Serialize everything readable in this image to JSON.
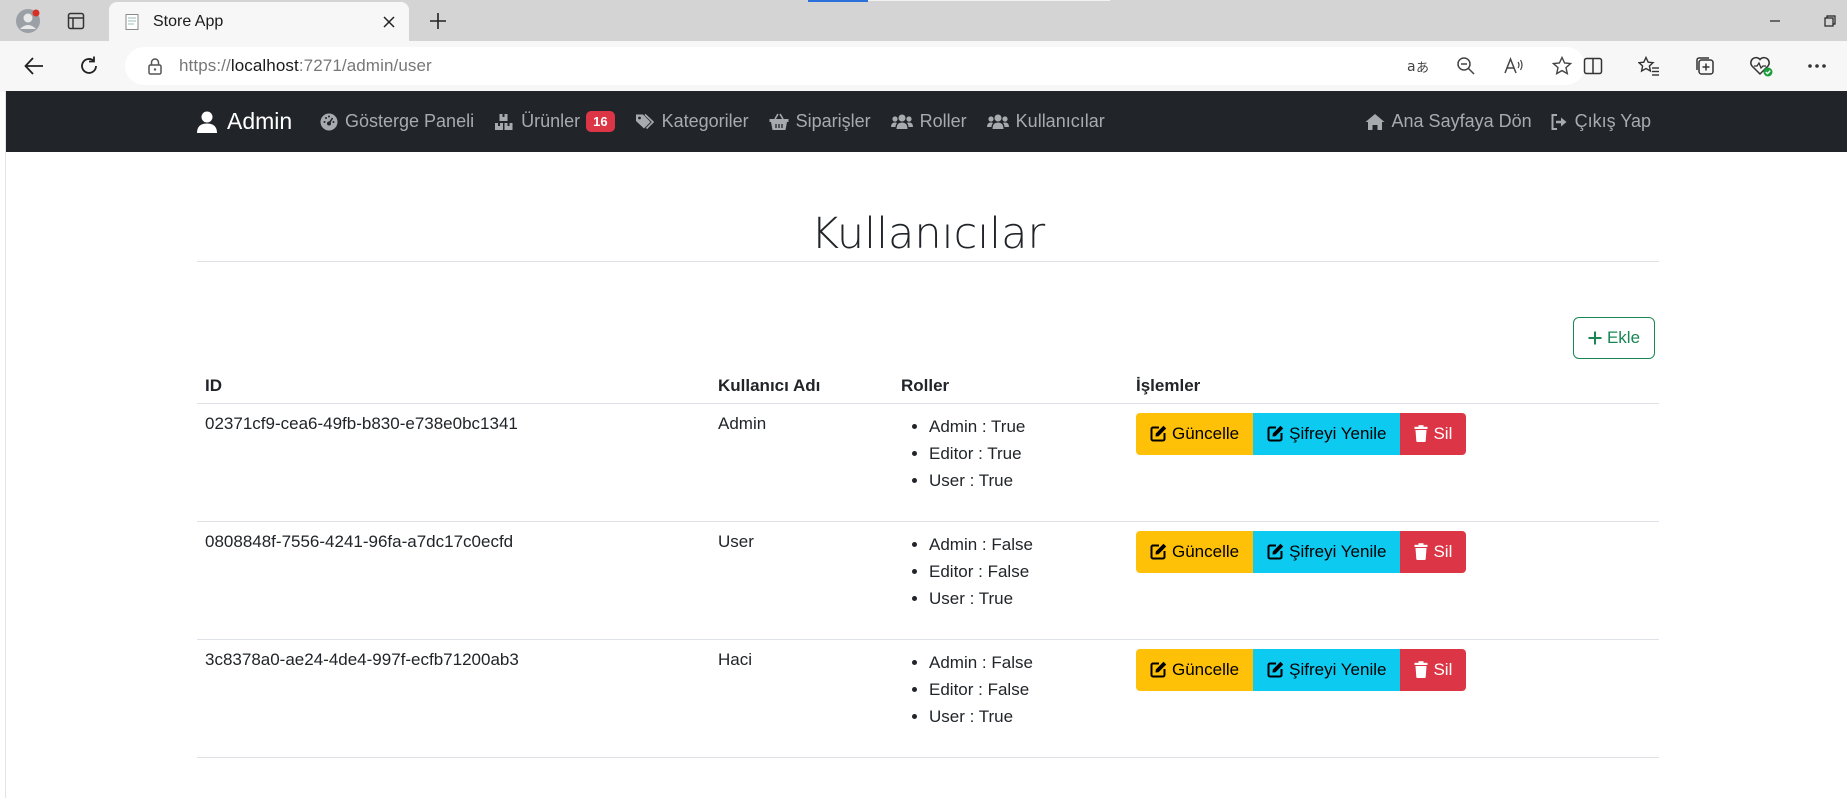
{
  "browser": {
    "tab_title": "Store App",
    "url_prefix": "https://",
    "url_host": "localhost",
    "url_rest": ":7271/admin/user"
  },
  "navbar": {
    "brand": "Admin",
    "items": [
      {
        "label": "Gösterge Paneli",
        "icon": "dashboard-icon"
      },
      {
        "label": "Ürünler",
        "icon": "boxes-icon",
        "badge": "16"
      },
      {
        "label": "Kategoriler",
        "icon": "tags-icon"
      },
      {
        "label": "Siparişler",
        "icon": "basket-icon"
      },
      {
        "label": "Roller",
        "icon": "users-icon"
      },
      {
        "label": "Kullanıcılar",
        "icon": "users-icon"
      }
    ],
    "right": [
      {
        "label": "Ana Sayfaya Dön",
        "icon": "home-icon"
      },
      {
        "label": "Çıkış Yap",
        "icon": "sign-out-icon"
      }
    ]
  },
  "page": {
    "title": "Kullanıcılar",
    "add_label": "Ekle"
  },
  "table": {
    "headers": [
      "ID",
      "Kullanıcı Adı",
      "Roller",
      "İşlemler"
    ],
    "rows": [
      {
        "id": "02371cf9-cea6-49fb-b830-e738e0bc1341",
        "username": "Admin",
        "roles": [
          "Admin : True",
          "Editor : True",
          "User : True"
        ]
      },
      {
        "id": "0808848f-7556-4241-96fa-a7dc17c0ecfd",
        "username": "User",
        "roles": [
          "Admin : False",
          "Editor : False",
          "User : True"
        ]
      },
      {
        "id": "3c8378a0-ae24-4de4-997f-ecfb71200ab3",
        "username": "Haci",
        "roles": [
          "Admin : False",
          "Editor : False",
          "User : True"
        ]
      }
    ],
    "actions": {
      "update": "Güncelle",
      "reset_password": "Şifreyi Yenile",
      "delete": "Sil"
    }
  },
  "colors": {
    "navbar_bg": "#212529",
    "warning": "#ffc107",
    "info": "#0dcaf0",
    "danger": "#dc3545",
    "success": "#198754"
  }
}
